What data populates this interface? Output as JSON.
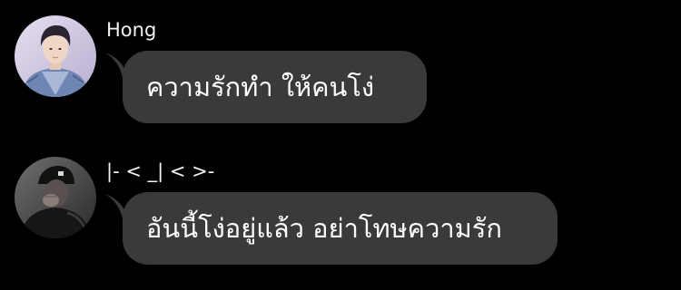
{
  "conversation": {
    "messages": [
      {
        "sender": "Hong",
        "text": "ความรักทำ ให้คนโง่",
        "avatar": "profile-photo-denim-jacket"
      },
      {
        "sender": "|- < _| < >-",
        "text": "อันนี้โง่อยู่แล้ว อย่าโทษความรัก",
        "avatar": "profile-photo-dark-hoodie"
      }
    ]
  },
  "colors": {
    "background": "#000000",
    "bubble": "#3a3a3c",
    "text": "#ffffff",
    "sender_name": "#f2f2f2"
  }
}
